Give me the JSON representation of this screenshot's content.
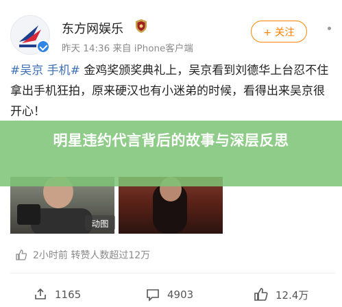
{
  "post": {
    "author": "东方网娱乐",
    "meta": "昨天 14:36  来自 iPhone客户端",
    "follow_label": "+ 关注",
    "hashtag": "#吴京 手机#",
    "body": " 金鸡奖颁奖典礼上，吴京看到刘德华上台忍不住拿出手机狂拍，原来硬汉也有小迷弟的时候，看得出来吴京很开心！",
    "gif_label": "动图"
  },
  "banner": {
    "title": "明星违约代言背后的故事与深层反思"
  },
  "engagement": {
    "stats_line": "2小时前 转赞人数超过12万",
    "repost_count": "1165",
    "comment_count": "4903",
    "like_count": "12.4万"
  },
  "colors": {
    "accent": "#ff8200",
    "hashtag": "#3b6fb3",
    "banner": "#7ec476",
    "verify": "#2f84e6"
  },
  "icons": {
    "avatar": "dongfang-logo",
    "badge": "shield-badge-icon",
    "like_small": "thumbs-up-icon",
    "repost": "repost-icon",
    "comment": "comment-icon",
    "like": "thumbs-up-icon",
    "more": "more-dots-icon"
  }
}
